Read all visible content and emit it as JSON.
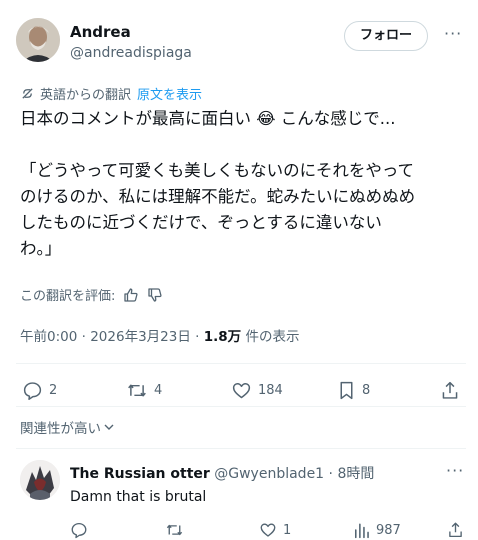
{
  "post": {
    "author_name": "Andrea",
    "author_handle": "@andreadispiaga",
    "follow_label": "フォロー",
    "more_label": "···",
    "translation_note": "英語からの翻訳",
    "show_original": "原文を表示",
    "body": "日本のコメントが最高に面白い 😂 こんな感じで...\n\n「どうやって可愛くも美しくもないのにそれをやって\nのけるのか、私には理解不能だ。蛇みたいにぬめぬめ\nしたものに近づくだけで、ぞっとするに違いない\nわ。」",
    "rate_translation": "この翻訳を評価:",
    "time": "午前0:00",
    "date": "2026年3月23日",
    "dot": "·",
    "views_count": "1.8万",
    "views_label": "件の表示",
    "actions": {
      "replies": "2",
      "reposts": "4",
      "likes": "184",
      "bookmarks": "8"
    },
    "related_label": "関連性が高い"
  },
  "reply": {
    "author_name": "The Russian otter",
    "author_handle": "@Gwyenblade1",
    "time": "8時間",
    "dot": "·",
    "text": "Damn that is brutal",
    "actions": {
      "likes": "1",
      "views": "987"
    }
  },
  "colors": {
    "text": "#0f1419",
    "muted": "#536471",
    "link": "#1d9bf0",
    "border": "#cfd9de",
    "divider": "#eff3f4"
  }
}
